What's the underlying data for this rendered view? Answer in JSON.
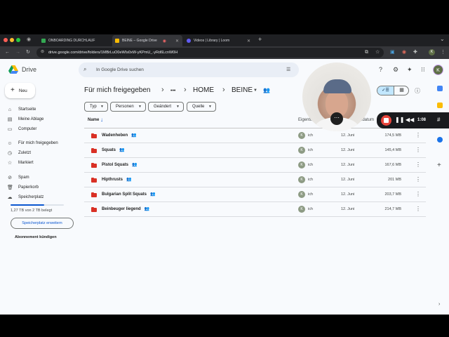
{
  "browser": {
    "tabs": [
      {
        "title": "ONBOARDING DURCHLAUF",
        "favicon_color": "#34a853"
      },
      {
        "title": "BEINE – Google Drive",
        "favicon_color": "#fbbc04"
      },
      {
        "title": "Videos | Library | Loom",
        "favicon_color": "#625df5"
      }
    ],
    "new_tab": "+",
    "url": "drive.google.com/drive/folders/1MBrLuO0eWIs0xW-yKPmU_-yRd6LcnW0H"
  },
  "drive": {
    "logo_text": "Drive",
    "new_button": "Neu",
    "search_placeholder": "In Google Drive suchen",
    "avatar": "K",
    "nav": [
      {
        "label": "Startseite",
        "icon": "home-icon"
      },
      {
        "label": "Meine Ablage",
        "icon": "drive-icon"
      },
      {
        "label": "Computer",
        "icon": "computer-icon"
      },
      {
        "label": "Für mich freigegeben",
        "icon": "shared-icon"
      },
      {
        "label": "Zuletzt",
        "icon": "clock-icon"
      },
      {
        "label": "Markiert",
        "icon": "star-icon"
      },
      {
        "label": "Spam",
        "icon": "spam-icon"
      },
      {
        "label": "Papierkorb",
        "icon": "trash-icon"
      },
      {
        "label": "Speicherplatz",
        "icon": "cloud-icon"
      }
    ],
    "storage": {
      "text": "1,27 TB von 2 TB belegt",
      "used_fraction": 0.635
    },
    "expand_storage": "Speicherplatz erweitern",
    "cancel_subscription": "Abonnement kündigen",
    "breadcrumb": [
      "Für mich freigegeben",
      "•••",
      "HOME",
      "BEINE"
    ],
    "filters": [
      "Typ",
      "Personen",
      "Geändert",
      "Quelle"
    ],
    "columns": {
      "name": "Name",
      "owner": "Eigentü",
      "modified": "gsdatum"
    },
    "files": [
      {
        "name": "Wadenheben",
        "owner": "ich",
        "date": "12. Juni",
        "size": "174,5 MB"
      },
      {
        "name": "Squats",
        "owner": "ich",
        "date": "12. Juni",
        "size": "145,4 MB"
      },
      {
        "name": "Pistol Squats",
        "owner": "ich",
        "date": "12. Juni",
        "size": "167,6 MB"
      },
      {
        "name": "Hipthrusts",
        "owner": "ich",
        "date": "12. Juni",
        "size": "201 MB"
      },
      {
        "name": "Bulgarian Split Squats",
        "owner": "ich",
        "date": "12. Juni",
        "size": "203,7 MB"
      },
      {
        "name": "Beinbeuger liegend",
        "owner": "ich",
        "date": "12. Juni",
        "size": "214,7 MB"
      }
    ],
    "owner_avatar": "K"
  },
  "recorder": {
    "time": "1:08"
  }
}
